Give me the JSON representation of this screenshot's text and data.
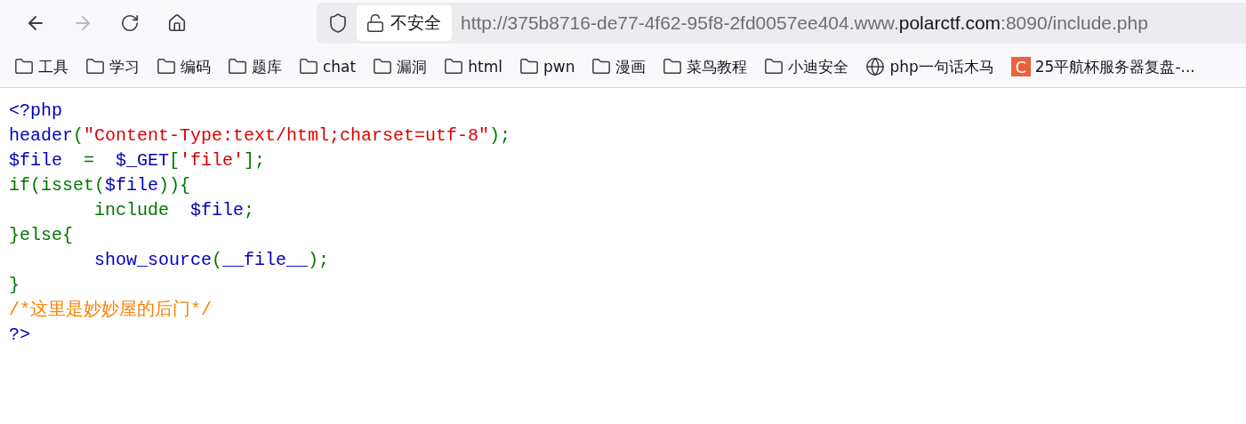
{
  "toolbar": {
    "back": {
      "disabled": false
    },
    "forward": {
      "disabled": true
    },
    "security_label": "不安全",
    "url": {
      "prefix": "http://375b8716-de77-4f62-95f8-2fd0057ee404.www.",
      "domain": "polarctf.com",
      "suffix": ":8090/include.php"
    }
  },
  "bookmarks": [
    {
      "kind": "folder",
      "label": "工具"
    },
    {
      "kind": "folder",
      "label": "学习"
    },
    {
      "kind": "folder",
      "label": "编码"
    },
    {
      "kind": "folder",
      "label": "题库"
    },
    {
      "kind": "folder",
      "label": "chat"
    },
    {
      "kind": "folder",
      "label": "漏洞"
    },
    {
      "kind": "folder",
      "label": "html"
    },
    {
      "kind": "folder",
      "label": "pwn"
    },
    {
      "kind": "folder",
      "label": "漫画"
    },
    {
      "kind": "folder",
      "label": "菜鸟教程"
    },
    {
      "kind": "folder",
      "label": "小迪安全"
    },
    {
      "kind": "globe",
      "label": "php一句话木马"
    },
    {
      "kind": "site",
      "label": "25平航杯服务器复盘-...",
      "icon_letter": "C"
    }
  ],
  "code": [
    [
      {
        "kind": "default",
        "text": "<?php"
      }
    ],
    [
      {
        "kind": "default",
        "text": "header"
      },
      {
        "kind": "keyword",
        "text": "("
      },
      {
        "kind": "string",
        "text": "\"Content-Type:text/html;charset=utf-8\""
      },
      {
        "kind": "keyword",
        "text": ");"
      }
    ],
    [
      {
        "kind": "default",
        "text": "$file  "
      },
      {
        "kind": "keyword",
        "text": "=  "
      },
      {
        "kind": "default",
        "text": "$_GET"
      },
      {
        "kind": "keyword",
        "text": "["
      },
      {
        "kind": "string",
        "text": "'file'"
      },
      {
        "kind": "keyword",
        "text": "];"
      }
    ],
    [
      {
        "kind": "keyword",
        "text": "if(isset("
      },
      {
        "kind": "default",
        "text": "$file"
      },
      {
        "kind": "keyword",
        "text": ")){"
      }
    ],
    [
      {
        "kind": "keyword",
        "text": "        include  "
      },
      {
        "kind": "default",
        "text": "$file"
      },
      {
        "kind": "keyword",
        "text": ";"
      }
    ],
    [
      {
        "kind": "keyword",
        "text": "}else{"
      }
    ],
    [
      {
        "kind": "default",
        "text": "        show_source"
      },
      {
        "kind": "keyword",
        "text": "("
      },
      {
        "kind": "default",
        "text": "__file__"
      },
      {
        "kind": "keyword",
        "text": ");"
      }
    ],
    [
      {
        "kind": "keyword",
        "text": "}"
      }
    ],
    [
      {
        "kind": "comment",
        "text": "/*这里是妙妙屋的后门*/"
      }
    ],
    [
      {
        "kind": "default",
        "text": "?>"
      }
    ]
  ]
}
